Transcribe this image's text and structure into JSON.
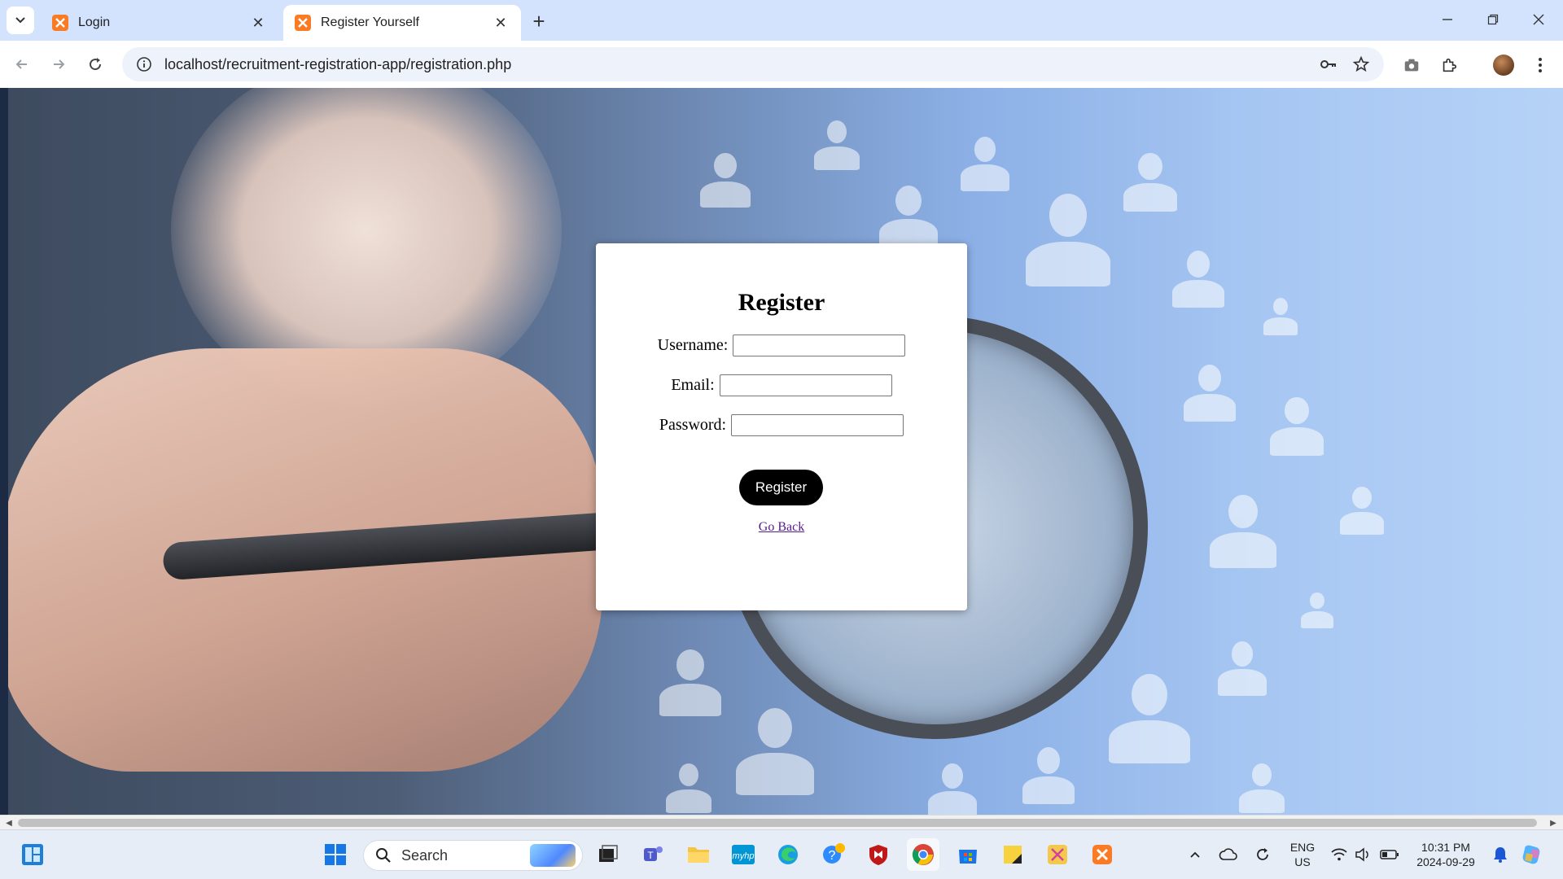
{
  "browser": {
    "tabs": [
      {
        "title": "Login",
        "active": false
      },
      {
        "title": "Register Yourself",
        "active": true
      }
    ],
    "url": "localhost/recruitment-registration-app/registration.php"
  },
  "page": {
    "form_title": "Register",
    "fields": [
      {
        "label": "Username:",
        "value": ""
      },
      {
        "label": "Email:",
        "value": ""
      },
      {
        "label": "Password:",
        "value": ""
      }
    ],
    "submit_label": "Register",
    "back_link": "Go Back"
  },
  "taskbar": {
    "search_label": "Search",
    "language": "ENG",
    "region": "US",
    "time": "10:31 PM",
    "date": "2024-09-29",
    "apps": [
      "windows-start",
      "task-view",
      "teams",
      "file-explorer",
      "myhp",
      "edge",
      "help",
      "mcafee",
      "chrome",
      "store",
      "sticky-notes",
      "snipping-tool",
      "xampp"
    ]
  },
  "colors": {
    "tabstrip": "#d3e3fd",
    "xampp_orange": "#fb7a24",
    "button_black": "#000000",
    "visited_link": "#551a8b"
  }
}
